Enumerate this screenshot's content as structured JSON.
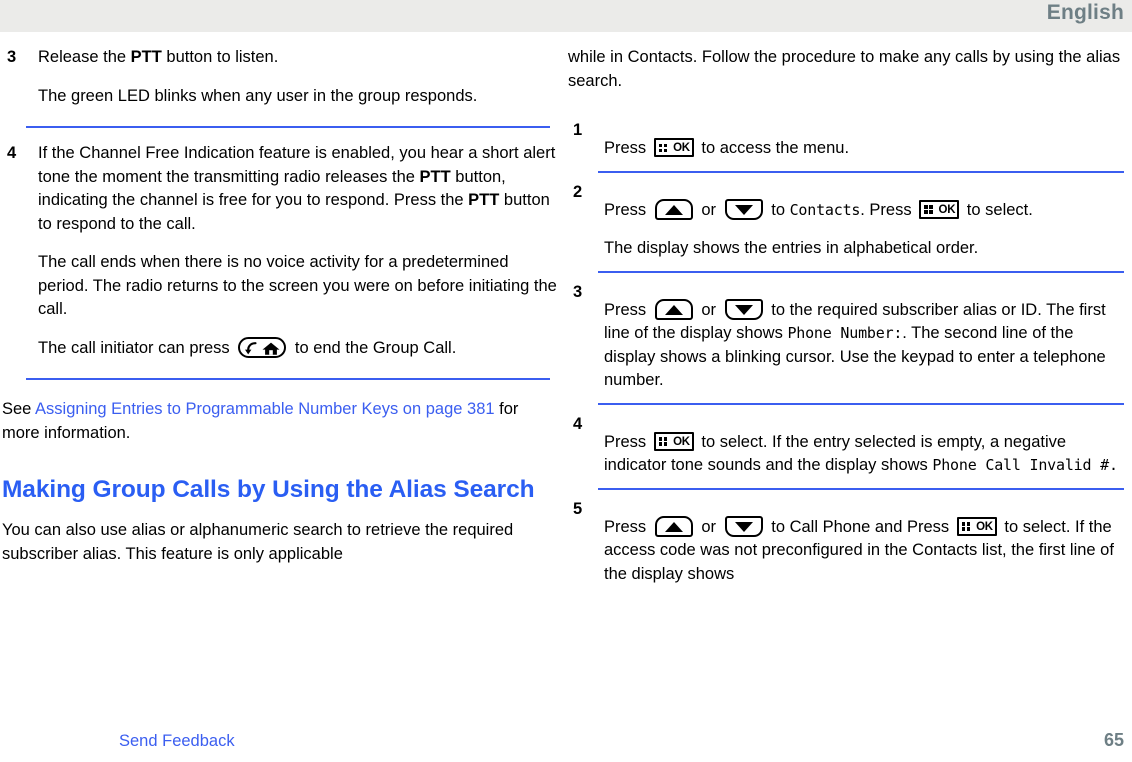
{
  "header": {
    "language_label": "English"
  },
  "footer": {
    "feedback_label": "Send Feedback",
    "page_number": "65"
  },
  "colors": {
    "link": "#3b5ef0",
    "heading": "#2a5ef3",
    "rule": "#3b5ef0",
    "header_band": "#ebebe9",
    "header_text": "#6e7f85",
    "page_number_text": "#6e7f85",
    "body_text": "#000000"
  },
  "left_column": {
    "steps": [
      {
        "number": "3",
        "lead_before": "Release the ",
        "lead_bold": "PTT",
        "lead_after": " button to listen.",
        "result": "The green LED blinks when any user in the group responds."
      },
      {
        "number": "4",
        "p1_a": "If the Channel Free Indication feature is enabled, you hear a short alert tone the moment the transmitting radio releases the ",
        "p1_bold1": "PTT",
        "p1_b": " button, indicating the channel is free for you to respond. Press the ",
        "p1_bold2": "PTT",
        "p1_c": " button to respond to the call.",
        "p2": "The call ends when there is no voice activity for a predetermined period. The radio returns to the screen you were on before initiating the call.",
        "p3_a": "The call initiator can press",
        "p3_icon": "back-home-key-icon",
        "p3_b": "to end the Group Call."
      }
    ],
    "see_also": {
      "prefix": "See ",
      "link_text": "Assigning Entries to Programmable Number Keys on page 381",
      "suffix": " for more information."
    },
    "section_heading": "Making Group Calls by Using the Alias Search",
    "intro_paragraph": "You can also use alias or alphanumeric search to retrieve the required subscriber alias. This feature is only applicable"
  },
  "right_column": {
    "continuation_paragraph": "while in Contacts. Follow the procedure to make any calls by using the alias search.",
    "steps": [
      {
        "number": "1",
        "t1": "Press",
        "icon1": "menu-ok-key-icon",
        "t2": "to access the menu."
      },
      {
        "number": "2",
        "t1": "Press",
        "icon1": "up-arrow-key-icon",
        "t2": "or",
        "icon2": "down-arrow-key-icon",
        "t3": "to ",
        "mono1": "Contacts",
        "t4": ". Press",
        "icon3": "menu-ok-key-icon",
        "t5": "to select.",
        "result": "The display shows the entries in alphabetical order."
      },
      {
        "number": "3",
        "t1": "Press",
        "icon1": "up-arrow-key-icon",
        "t2": "or",
        "icon2": "down-arrow-key-icon",
        "t3": "to the required subscriber alias or ID. The first line of the display shows ",
        "mono1": "Phone Number:",
        "t4": ". The second line of the display shows a blinking cursor. Use the keypad to enter a telephone number."
      },
      {
        "number": "4",
        "t1": "Press",
        "icon1": "menu-ok-key-icon",
        "t2": "to select. If the entry selected is empty, a negative indicator tone sounds and the display shows ",
        "mono1": "Phone Call Invalid #.",
        "t3": ""
      },
      {
        "number": "5",
        "t1": "Press",
        "icon1": "up-arrow-key-icon",
        "t2": "or",
        "icon2": "down-arrow-key-icon",
        "t3": "to Call Phone and Press",
        "icon3": "menu-ok-key-icon",
        "t4": "to select. If the access code was not preconfigured in the Contacts list, the first line of the display shows"
      }
    ]
  }
}
